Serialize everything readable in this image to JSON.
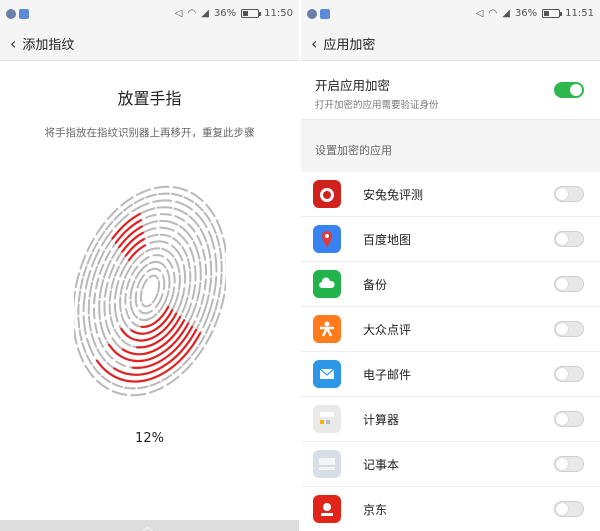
{
  "left": {
    "status": {
      "signal": "36%",
      "time": "11:50",
      "battery_level": 0.36
    },
    "header": {
      "title": "添加指纹"
    },
    "prompt": {
      "title": "放置手指",
      "instruction": "将手指放在指纹识别器上再移开，重复此步骤"
    },
    "progress": {
      "label": "12%",
      "value": 0.12
    }
  },
  "right": {
    "status": {
      "signal": "36%",
      "time": "11:51",
      "battery_level": 0.36
    },
    "header": {
      "title": "应用加密"
    },
    "encrypt": {
      "title": "开启应用加密",
      "subtitle": "打开加密的应用需要验证身份",
      "enabled": true
    },
    "section_label": "设置加密的应用",
    "apps": [
      {
        "name": "安兔兔评测",
        "icon": "antutu-icon",
        "color": "#d0211c",
        "enabled": false
      },
      {
        "name": "百度地图",
        "icon": "baidu-map-icon",
        "color": "#3a82f0",
        "enabled": false
      },
      {
        "name": "备份",
        "icon": "backup-cloud-icon",
        "color": "#23b34b",
        "enabled": false
      },
      {
        "name": "大众点评",
        "icon": "dianping-icon",
        "color": "#ff7a1a",
        "enabled": false
      },
      {
        "name": "电子邮件",
        "icon": "email-icon",
        "color": "#2c97e8",
        "enabled": false
      },
      {
        "name": "计算器",
        "icon": "calculator-icon",
        "color": "#e9e9e9",
        "enabled": false
      },
      {
        "name": "记事本",
        "icon": "notepad-icon",
        "color": "#d8dee5",
        "enabled": false
      },
      {
        "name": "京东",
        "icon": "jd-icon",
        "color": "#e1251b",
        "enabled": false
      }
    ]
  }
}
